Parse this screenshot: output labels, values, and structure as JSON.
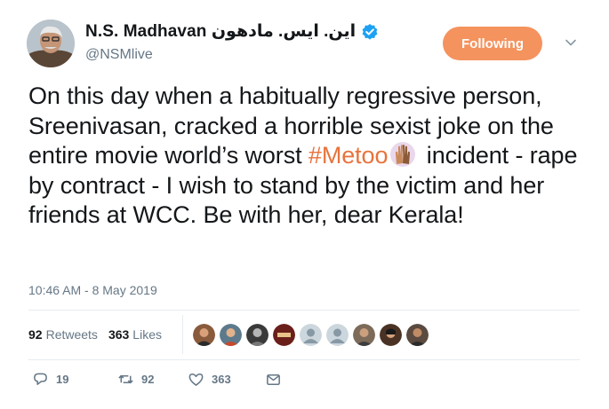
{
  "header": {
    "display_name": "N.S. Madhavan این. ایس. مادھون",
    "handle": "@NSMlive",
    "verified": true,
    "follow_button": "Following"
  },
  "tweet": {
    "text_before": "On this day when a habitually regressive person, Sreenivasan, cracked a horrible sexist joke on the entire movie world’s worst",
    "hashtag": "#Metoo",
    "text_after": "incident - rape by contract - I wish to stand by the victim and her friends at WCC. Be with her, dear Kerala!",
    "emoji": "raised-hands-emoji",
    "timestamp": "10:46 AM - 8 May 2019"
  },
  "stats": {
    "retweets_count": "92",
    "retweets_label": "Retweets",
    "likes_count": "363",
    "likes_label": "Likes"
  },
  "likers": [
    {
      "icon": "liker-avatar-1",
      "color": "#8a5a3c"
    },
    {
      "icon": "liker-avatar-2",
      "color": "#5d7a8c"
    },
    {
      "icon": "liker-avatar-3",
      "color": "#3a3a3a"
    },
    {
      "icon": "liker-avatar-4",
      "color": "#6b1f1a"
    },
    {
      "icon": "liker-avatar-5-default",
      "color": "#ccd6dd"
    },
    {
      "icon": "liker-avatar-6-default",
      "color": "#ccd6dd"
    },
    {
      "icon": "liker-avatar-7",
      "color": "#7d6b5a"
    },
    {
      "icon": "liker-avatar-8",
      "color": "#4a3324"
    },
    {
      "icon": "liker-avatar-9",
      "color": "#5b4a3f"
    }
  ],
  "actions": {
    "reply_count": "19",
    "retweet_count": "92",
    "like_count": "363"
  },
  "colors": {
    "follow_button": "#f4935e",
    "hashtag": "#e8733c",
    "verified": "#1da1f2",
    "secondary_text": "#657786"
  }
}
